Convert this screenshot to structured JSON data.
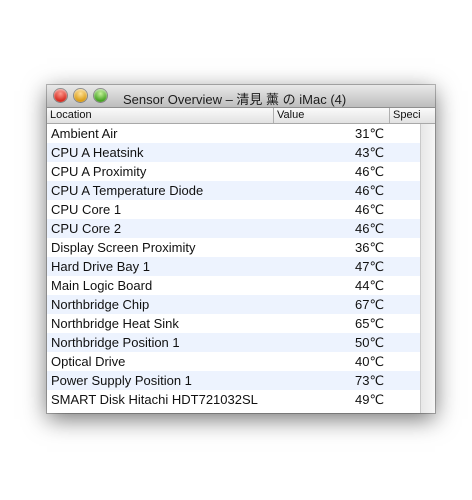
{
  "window": {
    "title": "Sensor Overview – 清見 薰 の iMac (4)"
  },
  "columns": {
    "location": "Location",
    "value": "Value",
    "specific": "Speci"
  },
  "sensors": [
    {
      "location": "Ambient Air",
      "value": "31℃"
    },
    {
      "location": "CPU A Heatsink",
      "value": "43℃"
    },
    {
      "location": "CPU A Proximity",
      "value": "46℃"
    },
    {
      "location": "CPU A Temperature Diode",
      "value": "46℃"
    },
    {
      "location": "CPU Core 1",
      "value": "46℃"
    },
    {
      "location": "CPU Core 2",
      "value": "46℃"
    },
    {
      "location": "Display Screen Proximity",
      "value": "36℃"
    },
    {
      "location": "Hard Drive Bay 1",
      "value": "47℃"
    },
    {
      "location": "Main Logic Board",
      "value": "44℃"
    },
    {
      "location": "Northbridge Chip",
      "value": "67℃"
    },
    {
      "location": "Northbridge Heat Sink",
      "value": "65℃"
    },
    {
      "location": "Northbridge Position 1",
      "value": "50℃"
    },
    {
      "location": "Optical Drive",
      "value": "40℃"
    },
    {
      "location": "Power Supply Position 1",
      "value": "73℃"
    },
    {
      "location": "SMART Disk Hitachi HDT721032SL",
      "value": "49℃"
    }
  ],
  "colors": {
    "close": "#d3261b",
    "minimize": "#d99a12",
    "zoom": "#3f9e1c",
    "alt_row": "#edf3fe"
  }
}
